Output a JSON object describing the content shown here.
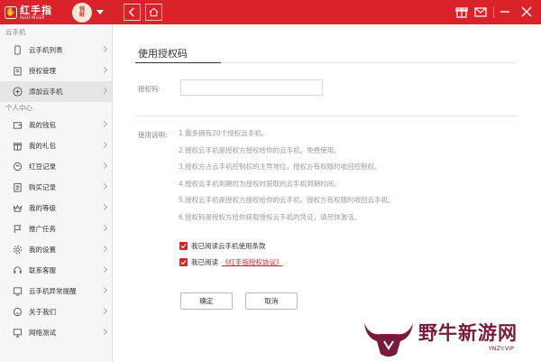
{
  "header": {
    "logo_title": "红手指",
    "logo_sub": "REDFINGER",
    "avatar_text_top": "钱",
    "avatar_text_bottom": "财"
  },
  "sidebar": {
    "section_cloud": "云手机",
    "cloud_items": [
      {
        "label": "云手机列表",
        "icon": "phone-icon"
      },
      {
        "label": "授权管理",
        "icon": "authorize-icon"
      },
      {
        "label": "添加云手机",
        "icon": "add-circle-icon"
      }
    ],
    "section_personal": "个人中心",
    "personal_items": [
      {
        "label": "我的钱包",
        "icon": "wallet-icon"
      },
      {
        "label": "我的礼包",
        "icon": "gift-icon"
      },
      {
        "label": "红豆记录",
        "icon": "bean-icon"
      },
      {
        "label": "购买记录",
        "icon": "purchase-record-icon"
      },
      {
        "label": "我的等级",
        "icon": "crown-icon"
      },
      {
        "label": "推广任务",
        "icon": "flag-icon"
      },
      {
        "label": "我的设置",
        "icon": "gear-icon"
      },
      {
        "label": "联系客服",
        "icon": "customer-service-icon"
      },
      {
        "label": "云手机异常提醒",
        "icon": "alert-icon"
      },
      {
        "label": "关于我们",
        "icon": "smile-icon"
      },
      {
        "label": "网络测试",
        "icon": "network-test-icon"
      }
    ]
  },
  "main": {
    "title": "使用授权码",
    "code_label": "授权码:",
    "code_value": "",
    "code_placeholder": "",
    "instructions_label": "使用说明:",
    "instructions": [
      "1.最多拥有20个授权云手机。",
      "2.授权云手机是授权方授权给你的云手机，免费使用。",
      "3.授权方占云手机控制权的主导地位，授权方有权随时收回控制权。",
      "4.授权云手机到期时为授权时获取的云手机到期时间。",
      "5.授权云手机是授权方授权给你的云手机，授权方有权随时收回云手机。",
      "6.授权码是授权方给你获取授权云手机的凭证，请尽快激活。"
    ],
    "check1_label": "我已阅读云手机使用条款",
    "check2_label": "我已阅读",
    "agreement_link": "《红手指授权协议》",
    "confirm_label": "确定",
    "cancel_label": "取消"
  },
  "watermark": {
    "title": "野牛新游网",
    "url": "YNZY.VIP"
  },
  "colors": {
    "brand_red": "#d9222a",
    "watermark": "#7a1a3d"
  }
}
